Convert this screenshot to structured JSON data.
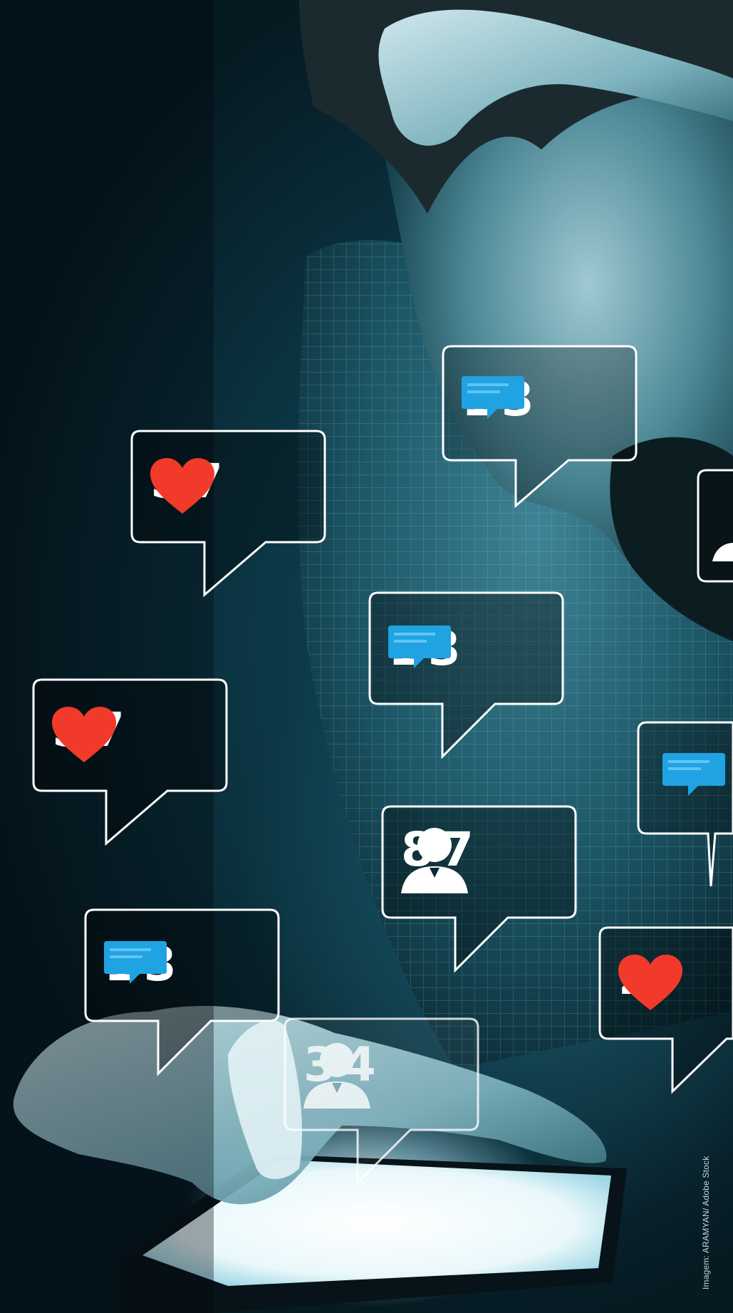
{
  "photo_credit": "Imagem: ARAMYAN/ Adobe Stock",
  "colors": {
    "heart": "#f23a2b",
    "comment": "#1fa3e3",
    "user": "#ffffff",
    "bubble_border": "#ffffff",
    "bubble_fill": "rgba(0,0,0,0.35)"
  },
  "bubbles": [
    {
      "id": "b1",
      "icon": "comment-icon",
      "count": "13"
    },
    {
      "id": "b2",
      "icon": "heart-icon",
      "count": "57"
    },
    {
      "id": "b3",
      "icon": "user-icon",
      "count": ""
    },
    {
      "id": "b4",
      "icon": "comment-icon",
      "count": "13"
    },
    {
      "id": "b5",
      "icon": "heart-icon",
      "count": "57"
    },
    {
      "id": "b6",
      "icon": "comment-icon",
      "count": ""
    },
    {
      "id": "b7",
      "icon": "user-icon",
      "count": "87"
    },
    {
      "id": "b8",
      "icon": "comment-icon",
      "count": "13"
    },
    {
      "id": "b9",
      "icon": "heart-icon",
      "count": "2"
    },
    {
      "id": "b10",
      "icon": "user-icon",
      "count": "34"
    }
  ]
}
